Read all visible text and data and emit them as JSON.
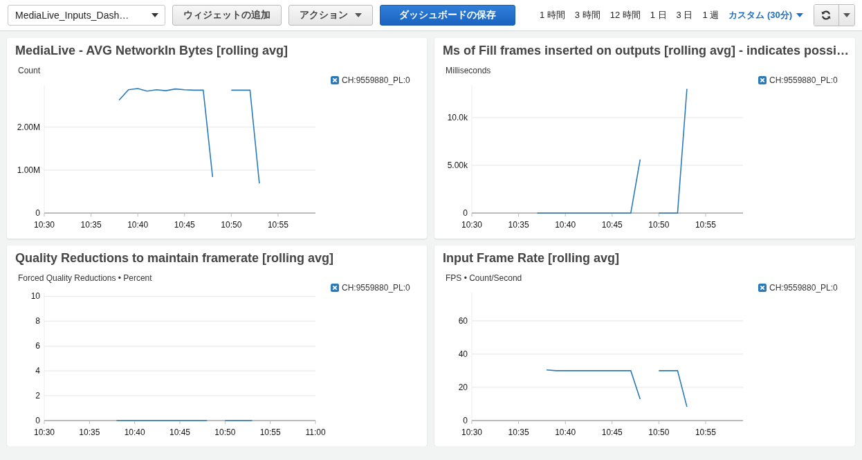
{
  "toolbar": {
    "dashboard_select": {
      "value": "MediaLive_Inputs_Dash…"
    },
    "buttons": [
      {
        "label": "ウィジェットの追加",
        "kind": "plain"
      },
      {
        "label": "アクション",
        "kind": "dropdown"
      },
      {
        "label": "ダッシュボードの保存",
        "kind": "primary"
      }
    ],
    "time_ranges": [
      {
        "label": "1 時間",
        "selected": false
      },
      {
        "label": "3 時間",
        "selected": false
      },
      {
        "label": "12 時間",
        "selected": false
      },
      {
        "label": "1 日",
        "selected": false
      },
      {
        "label": "3 日",
        "selected": false
      },
      {
        "label": "1 週",
        "selected": false
      },
      {
        "label": "カスタム (30分)",
        "selected": true
      }
    ]
  },
  "widgets": [
    {
      "title": "MediaLive - AVG NetworkIn Bytes [rolling avg]",
      "chart_data": {
        "type": "line",
        "ylabel": "Count",
        "grid": true,
        "ylim": [
          0,
          2980000
        ],
        "categories": [
          "10:30",
          null,
          null,
          null,
          null,
          "10:35",
          null,
          null,
          null,
          null,
          "10:40",
          null,
          null,
          null,
          null,
          "10:45",
          null,
          null,
          null,
          null,
          "10:50",
          null,
          null,
          null,
          null,
          "10:55",
          null,
          null,
          null,
          null
        ],
        "yticks": [
          {
            "value": 0,
            "label": "0"
          },
          {
            "value": 1000000,
            "label": "1.00M"
          },
          {
            "value": 2000000,
            "label": "2.00M"
          }
        ],
        "series": [
          {
            "name": "CH:9559880_PL:0",
            "color": "#2a7ab9",
            "values": [
              null,
              null,
              null,
              null,
              null,
              null,
              null,
              null,
              2630000,
              2870000,
              2900000,
              2840000,
              2870000,
              2850000,
              2890000,
              2870000,
              2860000,
              2860000,
              840000,
              null,
              2860000,
              2860000,
              2860000,
              690000,
              null,
              null,
              null,
              null,
              null,
              null
            ]
          }
        ]
      }
    },
    {
      "title": "Ms of Fill frames inserted on outputs [rolling avg] - indicates possi…",
      "chart_data": {
        "type": "line",
        "ylabel": "Milliseconds",
        "grid": true,
        "ylim": [
          0,
          13400
        ],
        "categories": [
          "10:30",
          null,
          null,
          null,
          null,
          "10:35",
          null,
          null,
          null,
          null,
          "10:40",
          null,
          null,
          null,
          null,
          "10:45",
          null,
          null,
          null,
          null,
          "10:50",
          null,
          null,
          null,
          null,
          "10:55",
          null,
          null,
          null,
          null
        ],
        "yticks": [
          {
            "value": 0,
            "label": "0"
          },
          {
            "value": 5000,
            "label": "5.00k"
          },
          {
            "value": 10000,
            "label": "10.0k"
          }
        ],
        "series": [
          {
            "name": "CH:9559880_PL:0",
            "color": "#2a7ab9",
            "values": [
              null,
              null,
              null,
              null,
              null,
              null,
              null,
              0,
              0,
              0,
              0,
              0,
              0,
              0,
              0,
              0,
              0,
              0,
              5600,
              null,
              0,
              0,
              0,
              13000,
              null,
              null,
              null,
              null,
              null,
              null
            ]
          }
        ]
      }
    },
    {
      "title": "Quality Reductions to maintain framerate [rolling avg]",
      "chart_data": {
        "type": "line",
        "ylabel": "Forced Quality Reductions • Percent",
        "grid": true,
        "ylim": [
          0,
          10.3
        ],
        "categories": [
          "10:30",
          null,
          null,
          null,
          null,
          "10:35",
          null,
          null,
          null,
          null,
          "10:40",
          null,
          null,
          null,
          null,
          "10:45",
          null,
          null,
          null,
          null,
          "10:50",
          null,
          null,
          null,
          null,
          "10:55",
          null,
          null,
          null,
          null,
          "11:00"
        ],
        "yticks": [
          0,
          2,
          4,
          6,
          8,
          10
        ],
        "series": [
          {
            "name": "CH:9559880_PL:0",
            "color": "#2a7ab9",
            "values": [
              null,
              null,
              null,
              null,
              null,
              null,
              null,
              null,
              0,
              0,
              0,
              0,
              0,
              0,
              0,
              0,
              0,
              0,
              0,
              null,
              0,
              0,
              0,
              0,
              null,
              null,
              null,
              null,
              null,
              null,
              null
            ]
          }
        ]
      }
    },
    {
      "title": "Input Frame Rate [rolling avg]",
      "chart_data": {
        "type": "line",
        "ylabel": "FPS • Count/Second",
        "grid": true,
        "ylim": [
          0,
          77
        ],
        "categories": [
          "10:30",
          null,
          null,
          null,
          null,
          "10:35",
          null,
          null,
          null,
          null,
          "10:40",
          null,
          null,
          null,
          null,
          "10:45",
          null,
          null,
          null,
          null,
          "10:50",
          null,
          null,
          null,
          null,
          "10:55",
          null,
          null,
          null,
          null
        ],
        "yticks": [
          0,
          20,
          40,
          60
        ],
        "series": [
          {
            "name": "CH:9559880_PL:0",
            "color": "#2a7ab9",
            "values": [
              null,
              null,
              null,
              null,
              null,
              null,
              null,
              null,
              30.5,
              30,
              30,
              30,
              30,
              30,
              30,
              30,
              30,
              30,
              12.9,
              null,
              30,
              30,
              30,
              8.3,
              null,
              null,
              null,
              null,
              null,
              null
            ]
          }
        ]
      }
    }
  ]
}
